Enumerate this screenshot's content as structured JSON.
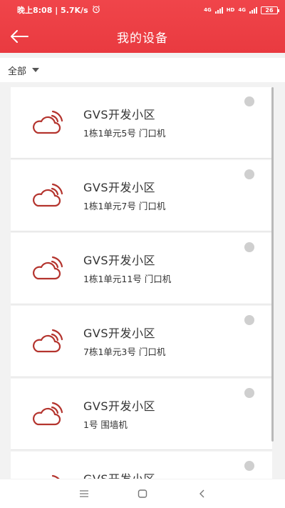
{
  "status_bar": {
    "left_text": "晚上8:08 | 5.7K/s",
    "alarm_icon": "alarm-icon",
    "network_badge_1": "4G",
    "network_badge_2": "HD",
    "network_badge_3": "4G",
    "battery": "26"
  },
  "header": {
    "title": "我的设备",
    "back_icon": "arrow-left-icon",
    "background_color": "#ea3e44"
  },
  "filter": {
    "label": "全部",
    "icon": "caret-down-icon"
  },
  "devices": [
    {
      "name": "GVS开发小区",
      "desc": "1栋1单元5号 门口机"
    },
    {
      "name": "GVS开发小区",
      "desc": "1栋1单元7号 门口机"
    },
    {
      "name": "GVS开发小区",
      "desc": "1栋1单元11号 门口机"
    },
    {
      "name": "GVS开发小区",
      "desc": "7栋1单元3号 门口机"
    },
    {
      "name": "GVS开发小区",
      "desc": "1号 围墙机"
    },
    {
      "name": "GVS开发小区",
      "desc": ""
    }
  ],
  "colors": {
    "accent": "#ea3e44",
    "icon_color": "#b4342e",
    "status_dot": "#cfcfcf"
  },
  "system_nav": {
    "menu_icon": "menu-icon",
    "home_icon": "home-square-icon",
    "back_icon": "back-chevron-icon"
  }
}
